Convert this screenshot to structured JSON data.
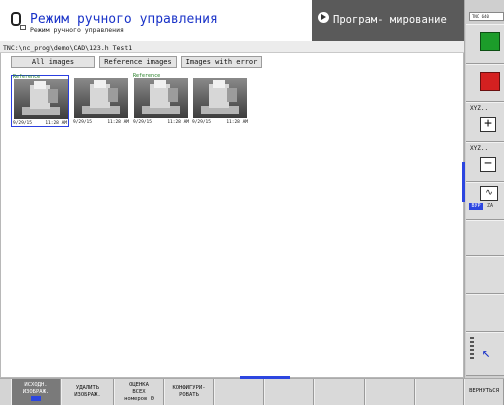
{
  "header": {
    "mode_title": "Режим ручного управления",
    "mode_subtitle": "Режим ручного управления",
    "program_title": "Програм- мирование"
  },
  "path_bar": {
    "path": "TNC:\\nc_prog\\demo\\CAD\\123.h Test1"
  },
  "filter_buttons": {
    "all": "All images",
    "reference": "Reference images",
    "error": "Images with error"
  },
  "thumbnails": [
    {
      "tag": "Reference",
      "date": "9/29/15",
      "time": "11:28 AM",
      "selected": true
    },
    {
      "tag": "",
      "date": "9/29/15",
      "time": "11:28 AM",
      "selected": false
    },
    {
      "tag": "Reference",
      "date": "9/29/15",
      "time": "11:28 AM",
      "selected": false
    },
    {
      "tag": "",
      "date": "9/29/15",
      "time": "11:28 AM",
      "selected": false
    }
  ],
  "right_panel": {
    "badge": "TNC 640",
    "plus_caption": "XYZ..",
    "minus_caption": "XYZ..",
    "toggle_on": "ВУР",
    "toggle_off": "ZA"
  },
  "softkeys": {
    "sk1": [
      "ИСХОДН.",
      "ИЗОБРАЖ."
    ],
    "sk2": [
      "УДАЛИТЬ",
      "ИЗОБРАЖ."
    ],
    "sk3": [
      "ОЦЕНКА",
      "ВСЕХ",
      "номеров 0"
    ],
    "sk4": [
      "КОНФИГУРИ-",
      "РОВАТЬ"
    ],
    "sk_back": "ВЕРНУТЬСЯ"
  },
  "colors": {
    "accent_blue": "#2c46e0",
    "header_dark": "#5a5a5a",
    "reference_green": "#1f7a1f",
    "start_green": "#1c9c2a",
    "stop_red": "#d42020"
  }
}
